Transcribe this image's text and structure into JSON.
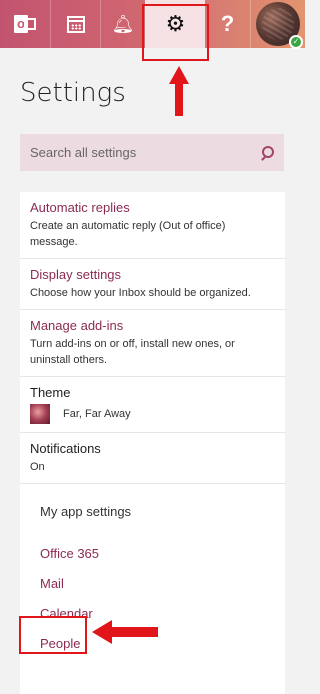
{
  "topbar": {
    "icons": [
      "outlook-icon",
      "calendar-icon",
      "bell-icon",
      "gear-icon",
      "help-icon",
      "avatar"
    ],
    "help_glyph": "?",
    "status": "online"
  },
  "settings": {
    "title": "Settings",
    "search": {
      "placeholder": "Search all settings"
    },
    "items": [
      {
        "label": "Automatic replies",
        "description": "Create an automatic reply (Out of office) message."
      },
      {
        "label": "Display settings",
        "description": "Choose how your Inbox should be organized."
      },
      {
        "label": "Manage add-ins",
        "description": "Turn add-ins on or off, install new ones, or uninstall others."
      }
    ],
    "theme": {
      "label": "Theme",
      "value": "Far, Far Away"
    },
    "notifications": {
      "label": "Notifications",
      "value": "On"
    },
    "app_settings": {
      "heading": "My app settings",
      "links": [
        "Office 365",
        "Mail",
        "Calendar",
        "People"
      ]
    }
  },
  "colors": {
    "accent": "#8b2b53",
    "highlight": "#e0161b",
    "topbar": "#cf6470"
  }
}
